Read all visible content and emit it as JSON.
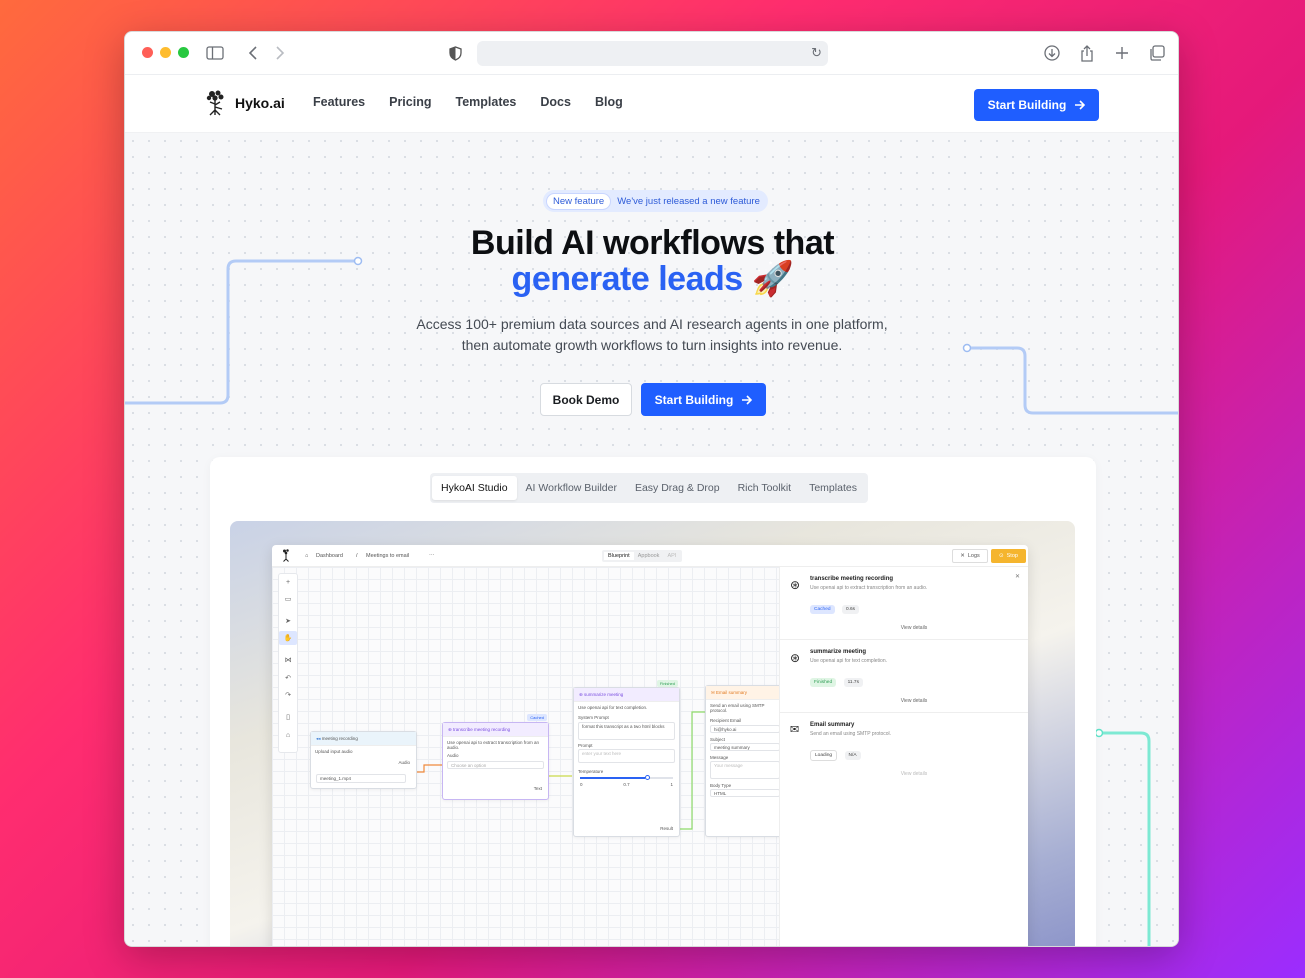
{
  "browser": {
    "traffic_colors": [
      "#ff5f57",
      "#febc2e",
      "#28c840"
    ]
  },
  "nav": {
    "logo_text": "Hyko.ai",
    "links": [
      "Features",
      "Pricing",
      "Templates",
      "Docs",
      "Blog"
    ],
    "cta_label": "Start Building"
  },
  "hero": {
    "badge_pill": "New feature",
    "badge_text": "We've just released a new feature",
    "title_line1": "Build AI workflows that",
    "title_line2": "generate leads 🚀",
    "subtitle": "Access 100+ premium data sources and AI research agents in one platform, then automate growth workflows to turn insights into revenue.",
    "btn_demo": "Book Demo",
    "btn_start": "Start Building",
    "accent_color": "#1f5eff"
  },
  "studio": {
    "tabs": [
      "HykoAI Studio",
      "AI Workflow Builder",
      "Easy Drag & Drop",
      "Rich Toolkit",
      "Templates"
    ],
    "active_tab": "HykoAI Studio",
    "app": {
      "breadcrumb": [
        "Dashboard",
        "Meetings to email"
      ],
      "view_tabs": [
        "Blueprint",
        "Appbook",
        "API"
      ],
      "logs_label": "Logs",
      "stop_label": "Stop",
      "nodes": {
        "meeting_recording": {
          "title": "meeting recording",
          "desc": "Upload input audio",
          "output": "Audio",
          "file": "meeting_1.mp4"
        },
        "transcribe": {
          "title": "transcribe meeting recording",
          "desc": "Use openai api to extract transcription from an audio.",
          "input": "Audio",
          "select": "Choose an option",
          "output": "Text",
          "badge": "Cached"
        },
        "summarize": {
          "title": "summarize meeting",
          "desc": "Use openai api for text completion.",
          "system_prompt_label": "System Prompt",
          "system_prompt": "format this transcript as a two html blocks",
          "prompt_label": "Prompt",
          "prompt_placeholder": "enter your text here",
          "temperature_label": "Temperature",
          "min": "0",
          "value": "0.7",
          "max": "1",
          "output": "Result",
          "badge": "Finished"
        },
        "email": {
          "title": "Email summary",
          "desc": "Send an email using SMTP protocol.",
          "recipient_label": "Recipient Email",
          "recipient": "hi@hyko.ai",
          "subject_label": "Subject",
          "subject": "meeting summary",
          "message_label": "Message",
          "message_placeholder": "Your message",
          "body_type_label": "Body Type",
          "body_type": "HTML"
        }
      },
      "runs": [
        {
          "title": "transcribe meeting recording",
          "desc": "Use openai api to extract transcription from an audio.",
          "status": "Cached",
          "time": "0.6s",
          "link": "View details"
        },
        {
          "title": "summarize meeting",
          "desc": "Use openai api for text completion.",
          "status": "Finished",
          "time": "11.7s",
          "link": "View details"
        },
        {
          "title": "Email summary",
          "desc": "Send an email using SMTP protocol.",
          "status": "Loading",
          "time": "N/A",
          "link": "View details"
        }
      ]
    }
  }
}
